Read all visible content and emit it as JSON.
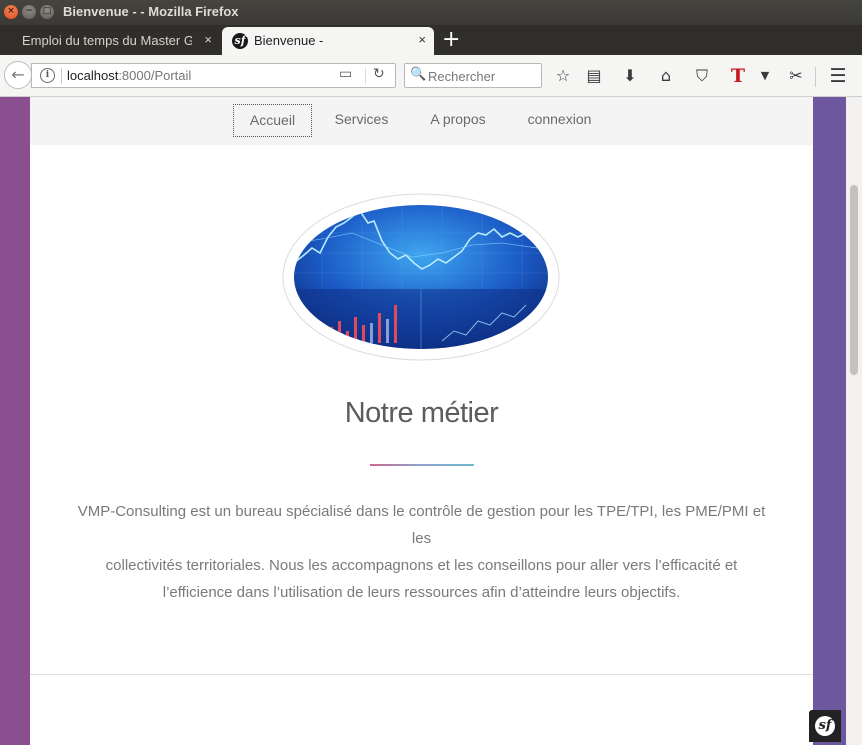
{
  "window": {
    "title": "Bienvenue - - Mozilla Firefox",
    "close_glyph": "×",
    "min_glyph": "−",
    "max_glyph": "□"
  },
  "tabs": [
    {
      "label": "Emploi du temps du Master GE",
      "close": "×",
      "active": false
    },
    {
      "label": "Bienvenue -",
      "close": "×",
      "active": true,
      "favicon": "sf"
    }
  ],
  "new_tab": "+",
  "navbar": {
    "back_glyph": "←",
    "info_glyph": "i",
    "url_host": "localhost",
    "url_rest": ":8000/Portail",
    "reader_glyph": "▭",
    "reload_glyph": "↻",
    "search_glyph": "🔍",
    "search_placeholder": "Rechercher",
    "icons": {
      "bookmark": "☆",
      "library": "▤",
      "download": "⬇",
      "home": "⌂",
      "pocket": "⛉",
      "t_addon": "T",
      "dropdown": "▼",
      "screenshot": "✂",
      "menu": "☰"
    }
  },
  "site_nav": [
    {
      "label": "Accueil",
      "current": true
    },
    {
      "label": "Services",
      "current": false
    },
    {
      "label": "A propos",
      "current": false
    },
    {
      "label": "connexion",
      "current": false
    }
  ],
  "main": {
    "heading": "Notre métier",
    "intro_line1": "VMP-Consulting est un bureau spécialisé dans le contrôle de gestion pour les TPE/TPI, les PME/PMI et les",
    "intro_line2": "collectivités territoriales. Nous les accompagnons et les conseillons pour aller vers l’efficacité et",
    "intro_line3": "l’efficience dans l’utilisation de leurs ressources afin d’atteindre leurs objectifs."
  },
  "symfony_badge": "sf",
  "colors": {
    "accent_gradient_start": "#c9698e",
    "accent_gradient_end": "#6cbbd0",
    "background_purple": "#7c5192",
    "hero_blue": "#1c4fb8"
  }
}
